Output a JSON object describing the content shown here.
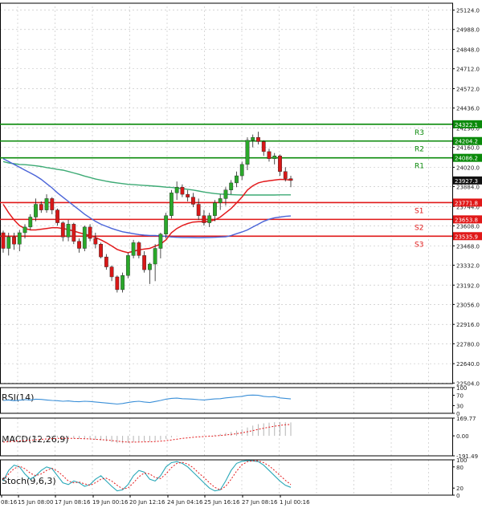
{
  "colors": {
    "background": "#ffffff",
    "grid": "#c8c8c8",
    "axis": "#000000",
    "bull": "#2aa82a",
    "bear": "#d81818",
    "resistance": "#0a8a0a",
    "support": "#e01818",
    "price_badge": "#111111",
    "ma_red": "#e31a1c",
    "ma_blue": "#4a64d8",
    "ma_green": "#3caa74",
    "rsi": "#3a8fd8",
    "macd_hist": "#b4b4b4",
    "macd_signal": "#e31a1c",
    "stoch_k": "#2aa8b8",
    "stoch_d": "#e31a1c"
  },
  "chart_data": {
    "type": "candlestick",
    "price_axis": {
      "ticks": [
        "25124.0",
        "24988.0",
        "24848.0",
        "24712.0",
        "24572.0",
        "24436.0",
        "24296.0",
        "24160.0",
        "24020.0",
        "23884.0",
        "23744.0",
        "23608.0",
        "23468.0",
        "23332.0",
        "23192.0",
        "23056.0",
        "22916.0",
        "22780.0",
        "22640.0",
        "22504.0"
      ],
      "ylim": [
        22500,
        25150
      ]
    },
    "time_axis": {
      "labels": [
        "08:16",
        "15 Jun 08:00",
        "17 Jun 08:16",
        "19 Jun 00:16",
        "20 Jun 12:16",
        "24 Jun 04:16",
        "25 Jun 16:16",
        "27 Jun 08:16",
        "1 Jul 00:16"
      ]
    },
    "levels": [
      {
        "name": "R3",
        "value": 24322.1,
        "label": "24322.1",
        "kind": "resistance"
      },
      {
        "name": "R2",
        "value": 24204.2,
        "label": "24204.2",
        "kind": "resistance"
      },
      {
        "name": "R1",
        "value": 24086.2,
        "label": "24086.2",
        "kind": "resistance"
      },
      {
        "name": "S1",
        "value": 23771.8,
        "label": "23771.8",
        "kind": "support"
      },
      {
        "name": "S2",
        "value": 23653.8,
        "label": "23653.8",
        "kind": "support"
      },
      {
        "name": "S3",
        "value": 23535.9,
        "label": "23535.9",
        "kind": "support"
      }
    ],
    "current_price": {
      "value": 23927.3,
      "label": "23927.3"
    },
    "candles": [
      [
        23560,
        23575,
        23420,
        23450
      ],
      [
        23450,
        23560,
        23400,
        23530
      ],
      [
        23530,
        23560,
        23440,
        23480
      ],
      [
        23480,
        23580,
        23430,
        23560
      ],
      [
        23560,
        23620,
        23520,
        23600
      ],
      [
        23600,
        23690,
        23580,
        23670
      ],
      [
        23670,
        23800,
        23640,
        23760
      ],
      [
        23760,
        23780,
        23700,
        23720
      ],
      [
        23720,
        23830,
        23700,
        23800
      ],
      [
        23800,
        23810,
        23690,
        23720
      ],
      [
        23720,
        23730,
        23610,
        23630
      ],
      [
        23630,
        23640,
        23500,
        23530
      ],
      [
        23530,
        23650,
        23500,
        23620
      ],
      [
        23620,
        23630,
        23480,
        23500
      ],
      [
        23500,
        23520,
        23420,
        23450
      ],
      [
        23450,
        23610,
        23430,
        23600
      ],
      [
        23600,
        23620,
        23500,
        23520
      ],
      [
        23520,
        23560,
        23450,
        23480
      ],
      [
        23480,
        23490,
        23380,
        23390
      ],
      [
        23390,
        23410,
        23300,
        23320
      ],
      [
        23320,
        23330,
        23220,
        23250
      ],
      [
        23250,
        23260,
        23140,
        23160
      ],
      [
        23160,
        23280,
        23140,
        23260
      ],
      [
        23260,
        23420,
        23240,
        23400
      ],
      [
        23400,
        23510,
        23380,
        23490
      ],
      [
        23490,
        23500,
        23380,
        23400
      ],
      [
        23400,
        23430,
        23280,
        23300
      ],
      [
        23300,
        23350,
        23200,
        23340
      ],
      [
        23340,
        23480,
        23220,
        23450
      ],
      [
        23450,
        23560,
        23380,
        23550
      ],
      [
        23550,
        23700,
        23520,
        23680
      ],
      [
        23680,
        23860,
        23660,
        23840
      ],
      [
        23840,
        23920,
        23790,
        23880
      ],
      [
        23880,
        23900,
        23810,
        23830
      ],
      [
        23830,
        23860,
        23780,
        23810
      ],
      [
        23810,
        23840,
        23740,
        23760
      ],
      [
        23760,
        23800,
        23650,
        23680
      ],
      [
        23680,
        23720,
        23610,
        23630
      ],
      [
        23630,
        23700,
        23600,
        23680
      ],
      [
        23680,
        23790,
        23640,
        23770
      ],
      [
        23770,
        23830,
        23720,
        23800
      ],
      [
        23800,
        23880,
        23750,
        23860
      ],
      [
        23860,
        23930,
        23830,
        23910
      ],
      [
        23910,
        23990,
        23880,
        23960
      ],
      [
        23960,
        24060,
        23930,
        24040
      ],
      [
        24040,
        24230,
        24000,
        24210
      ],
      [
        24210,
        24250,
        24160,
        24230
      ],
      [
        24230,
        24270,
        24180,
        24200
      ],
      [
        24200,
        24210,
        24100,
        24130
      ],
      [
        24130,
        24150,
        24060,
        24080
      ],
      [
        24080,
        24120,
        24040,
        24100
      ],
      [
        24100,
        24110,
        23960,
        23990
      ],
      [
        23990,
        24020,
        23920,
        23940
      ],
      [
        23940,
        23960,
        23880,
        23927
      ]
    ],
    "indicators": [
      {
        "label": "RSI(14)",
        "ticks": [
          "100",
          "70",
          "30",
          "0"
        ]
      },
      {
        "label": "MACD(12,26,9)",
        "ticks": [
          "169.77",
          "0.00",
          "-191.49"
        ]
      },
      {
        "label": "Stoch(9,6,3)",
        "ticks": [
          "100",
          "80",
          "20",
          "0"
        ]
      }
    ],
    "ma_red": [
      23760,
      23700,
      23650,
      23610,
      23590,
      23580,
      23580,
      23585,
      23590,
      23595,
      23595,
      23590,
      23582,
      23572,
      23560,
      23550,
      23540,
      23527,
      23510,
      23490,
      23467,
      23443,
      23430,
      23420,
      23430,
      23440,
      23445,
      23450,
      23465,
      23480,
      23510,
      23560,
      23590,
      23610,
      23625,
      23635,
      23637,
      23638,
      23640,
      23650,
      23670,
      23700,
      23730,
      23770,
      23810,
      23860,
      23890,
      23910,
      23920,
      23925,
      23930,
      23935,
      23933,
      23930
    ],
    "ma_blue": [
      24080,
      24060,
      24040,
      24020,
      24000,
      23980,
      23960,
      23935,
      23905,
      23875,
      23840,
      23810,
      23780,
      23750,
      23720,
      23690,
      23665,
      23640,
      23620,
      23605,
      23590,
      23578,
      23567,
      23560,
      23553,
      23547,
      23543,
      23540,
      23540,
      23538,
      23535,
      23530,
      23528,
      23527,
      23527,
      23526,
      23525,
      23526,
      23527,
      23528,
      23530,
      23532,
      23540,
      23553,
      23565,
      23580,
      23600,
      23620,
      23640,
      23655,
      23665,
      23670,
      23675,
      23678
    ],
    "ma_green": [
      24060,
      24050,
      24045,
      24040,
      24038,
      24035,
      24030,
      24025,
      24018,
      24012,
      24005,
      24000,
      23990,
      23980,
      23970,
      23958,
      23948,
      23937,
      23930,
      23922,
      23915,
      23910,
      23905,
      23900,
      23898,
      23895,
      23892,
      23890,
      23887,
      23884,
      23880,
      23878,
      23874,
      23870,
      23865,
      23860,
      23853,
      23846,
      23840,
      23835,
      23832,
      23830,
      23828,
      23826,
      23825,
      23825,
      23825,
      23825,
      23825,
      23825,
      23825,
      23826,
      23826,
      23826
    ],
    "rsi": [
      50,
      52,
      49,
      51,
      53,
      52,
      55,
      54,
      52,
      50,
      49,
      47,
      48,
      46,
      45,
      47,
      46,
      44,
      42,
      40,
      38,
      36,
      38,
      42,
      45,
      47,
      44,
      42,
      46,
      50,
      55,
      58,
      59,
      57,
      56,
      55,
      53,
      52,
      54,
      56,
      57,
      60,
      62,
      64,
      66,
      70,
      71,
      70,
      66,
      64,
      65,
      60,
      58,
      56
    ],
    "macd_hist": [
      -40,
      -35,
      -32,
      -30,
      -28,
      -25,
      -20,
      -18,
      -15,
      -14,
      -16,
      -20,
      -22,
      -25,
      -30,
      -32,
      -34,
      -38,
      -44,
      -52,
      -60,
      -70,
      -72,
      -68,
      -60,
      -55,
      -55,
      -54,
      -48,
      -40,
      -28,
      -15,
      -5,
      0,
      2,
      3,
      2,
      1,
      4,
      10,
      18,
      28,
      38,
      50,
      62,
      80,
      98,
      112,
      120,
      126,
      130,
      132,
      130,
      128
    ],
    "macd_signal": [
      -60,
      -56,
      -52,
      -48,
      -45,
      -42,
      -38,
      -34,
      -30,
      -27,
      -25,
      -24,
      -24,
      -25,
      -26,
      -28,
      -30,
      -33,
      -36,
      -40,
      -45,
      -51,
      -56,
      -59,
      -60,
      -59,
      -58,
      -57,
      -55,
      -51,
      -46,
      -39,
      -32,
      -25,
      -19,
      -14,
      -10,
      -7,
      -4,
      -1,
      3,
      8,
      14,
      21,
      29,
      39,
      50,
      62,
      73,
      83,
      92,
      100,
      106,
      110
    ],
    "stoch_k": [
      40,
      70,
      85,
      80,
      60,
      45,
      55,
      70,
      80,
      75,
      55,
      35,
      30,
      40,
      35,
      25,
      30,
      45,
      55,
      40,
      25,
      12,
      15,
      30,
      55,
      70,
      65,
      45,
      40,
      55,
      80,
      92,
      95,
      90,
      80,
      65,
      50,
      35,
      20,
      12,
      15,
      40,
      70,
      90,
      96,
      98,
      97,
      95,
      85,
      70,
      55,
      40,
      28,
      22
    ],
    "stoch_d": [
      45,
      60,
      75,
      82,
      75,
      62,
      55,
      60,
      70,
      76,
      68,
      55,
      40,
      35,
      37,
      32,
      28,
      35,
      45,
      48,
      40,
      28,
      18,
      20,
      35,
      52,
      63,
      60,
      50,
      47,
      60,
      78,
      90,
      93,
      88,
      78,
      63,
      50,
      35,
      22,
      15,
      25,
      45,
      68,
      86,
      95,
      97,
      97,
      92,
      83,
      70,
      56,
      42,
      30
    ]
  }
}
